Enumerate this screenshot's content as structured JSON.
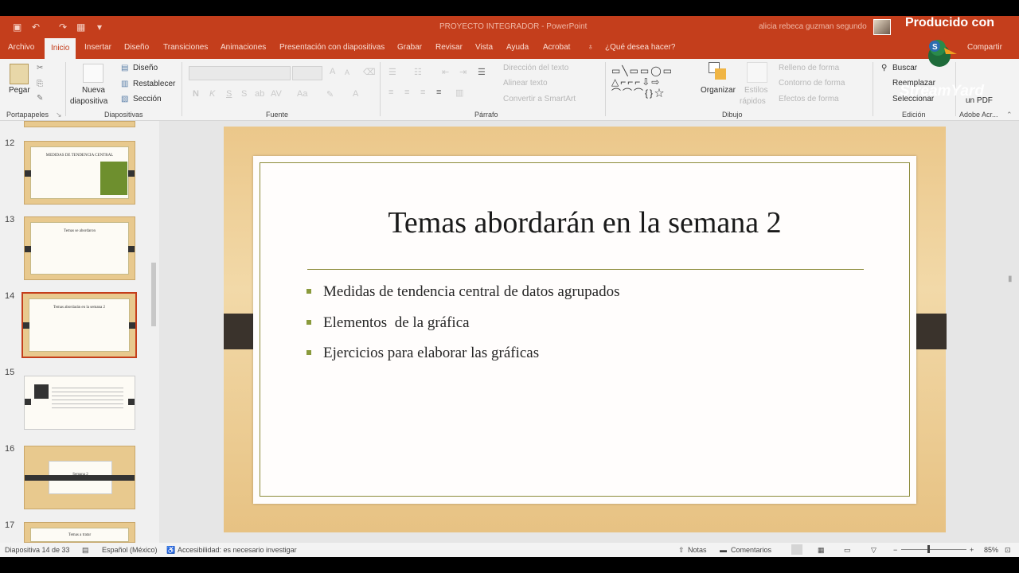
{
  "app": {
    "title": "PROYECTO INTEGRADOR  -  PowerPoint",
    "user": "alicia rebeca guzman segundo",
    "accent": "#c43e1c"
  },
  "tabs": [
    "Archivo",
    "Inicio",
    "Insertar",
    "Diseño",
    "Transiciones",
    "Animaciones",
    "Presentación con diapositivas",
    "Grabar",
    "Revisar",
    "Vista",
    "Ayuda",
    "Acrobat"
  ],
  "tell_me": "¿Qué desea hacer?",
  "share": "Compartir",
  "ribbon": {
    "portapapeles": {
      "pegar": "Pegar",
      "label": "Portapapeles"
    },
    "diapositivas": {
      "nueva": "Nueva",
      "diapositiva": "diapositiva",
      "diseno": "Diseño",
      "restablecer": "Restablecer",
      "seccion": "Sección",
      "label": "Diapositivas"
    },
    "fuente": {
      "label": "Fuente",
      "n": "N",
      "k": "K",
      "s": "S",
      "s2": "S",
      "a_up": "A",
      "a_down": "A"
    },
    "parrafo": {
      "label": "Párrafo",
      "direccion": "Dirección del texto",
      "alinear": "Alinear texto",
      "convertir": "Convertir a SmartArt"
    },
    "dibujo": {
      "label": "Dibujo",
      "organizar": "Organizar",
      "estilos1": "Estilos",
      "estilos2": "rápidos",
      "relleno": "Relleno de forma",
      "contorno": "Contorno de forma",
      "efectos": "Efectos de forma"
    },
    "edicion": {
      "label": "Edición",
      "buscar": "Buscar",
      "reemplazar": "Reemplazar",
      "seleccionar": "Seleccionar"
    },
    "adobe": {
      "label": "Adobe Acr...",
      "pdf": "un PDF"
    }
  },
  "thumbnails": [
    {
      "num": "12",
      "title": "MEDIDAS DE TENDENCIA CENTRAL"
    },
    {
      "num": "13",
      "title": "Temas se abordaron"
    },
    {
      "num": "14",
      "title": "Temas abordarán en la semana 2"
    },
    {
      "num": "15",
      "title": ""
    },
    {
      "num": "16",
      "title": "Semana 2"
    },
    {
      "num": "17",
      "title": "Temas a tratar"
    }
  ],
  "slide": {
    "title": "Temas abordarán en la semana 2",
    "bullets": [
      "Medidas de tendencia central de datos agrupados",
      "Elementos  de la gráfica",
      "Ejercicios para elaborar las gráficas"
    ]
  },
  "status": {
    "slide_of": "Diapositiva 14 de 33",
    "language": "Español (México)",
    "accessibility": "Accesibilidad: es necesario investigar",
    "notas": "Notas",
    "comentarios": "Comentarios",
    "zoom": "85%"
  },
  "overlay": {
    "producido": "Producido con",
    "streamyard": "StreamYard"
  }
}
